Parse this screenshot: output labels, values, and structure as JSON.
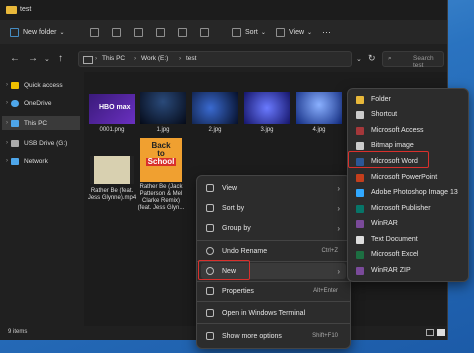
{
  "window": {
    "title": "test"
  },
  "toolbar": {
    "new_label": "New folder",
    "sort_label": "Sort",
    "view_label": "View"
  },
  "nav": {
    "back": "←",
    "forward": "→",
    "up": "↑",
    "breadcrumb": [
      "This PC",
      "Work (E:)",
      "test"
    ],
    "search_placeholder": "Search test"
  },
  "sidebar": {
    "items": [
      {
        "label": "Quick access",
        "color": "#f0c000"
      },
      {
        "label": "OneDrive",
        "color": "#4ea6ea"
      },
      {
        "label": "This PC",
        "color": "#4ea6ea"
      },
      {
        "label": "USB Drive (G:)",
        "color": "#aaaaaa"
      },
      {
        "label": "Network",
        "color": "#4ea6ea"
      }
    ]
  },
  "files": [
    {
      "name": "0001.png",
      "color": "#5b2aa8"
    },
    {
      "name": "1.jpg",
      "color": "#0c1e3a"
    },
    {
      "name": "2.jpg",
      "color": "#0a1a40"
    },
    {
      "name": "3.jpg",
      "color": "#2a2a8a"
    },
    {
      "name": "4.jpg",
      "color": "#1a3a90"
    },
    {
      "name_lines": [
        "Rather Be (feat.",
        "Jess Glynne).mp4"
      ],
      "color": "#3a3a3a"
    },
    {
      "name_lines": [
        "Rather Be (Jack",
        "Patterson & Mel",
        "Clarke Remix)",
        "(feat. Jess Glyn..."
      ],
      "color": "#e08020",
      "art_lines": [
        "Back",
        "to",
        "School"
      ]
    }
  ],
  "status": {
    "items": "9 items"
  },
  "context_menu": [
    {
      "label": "View",
      "shortcut": "",
      "arrow": "›"
    },
    {
      "label": "Sort by",
      "shortcut": "",
      "arrow": "›"
    },
    {
      "label": "Group by",
      "shortcut": "",
      "arrow": "›"
    },
    {
      "label": "Undo Rename",
      "shortcut": "Ctrl+Z",
      "arrow": ""
    },
    {
      "label": "New",
      "shortcut": "",
      "arrow": "›"
    },
    {
      "label": "Properties",
      "shortcut": "Alt+Enter",
      "arrow": ""
    },
    {
      "label": "Open in Windows Terminal",
      "shortcut": "",
      "arrow": ""
    },
    {
      "label": "Show more options",
      "shortcut": "Shift+F10",
      "arrow": ""
    }
  ],
  "new_submenu": [
    {
      "label": "Folder",
      "color": "#e8b83a"
    },
    {
      "label": "Shortcut",
      "color": "#cccccc"
    },
    {
      "label": "Microsoft Access",
      "color": "#a4373a"
    },
    {
      "label": "Bitmap image",
      "color": "#cccccc"
    },
    {
      "label": "Microsoft Word",
      "color": "#2b5797"
    },
    {
      "label": "Microsoft PowerPoint",
      "color": "#c43e1c"
    },
    {
      "label": "Adobe Photoshop Image 13",
      "color": "#31a8ff"
    },
    {
      "label": "Microsoft Publisher",
      "color": "#077568"
    },
    {
      "label": "WinRAR",
      "color": "#7a4a9a"
    },
    {
      "label": "Text Document",
      "color": "#dddddd"
    },
    {
      "label": "Microsoft Excel",
      "color": "#1d6f42"
    },
    {
      "label": "WinRAR ZIP",
      "color": "#7a4a9a"
    }
  ]
}
